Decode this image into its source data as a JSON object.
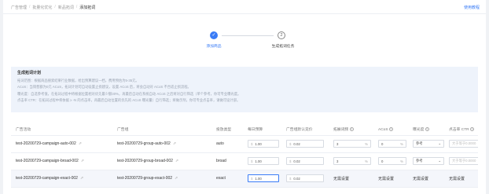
{
  "breadcrumb": [
    "广告管理",
    "批量化优化",
    "新品拓词",
    "添加拓词"
  ],
  "help_link": "使用教程",
  "steps": [
    {
      "num": "✓",
      "label": "添加商品"
    },
    {
      "num": "2",
      "label": "生成拓词任务"
    }
  ],
  "notice": {
    "title": "生成拓词计划",
    "lines": [
      "拓词范围：根据商品搜索结果行业数据，给出预算建议一档，费用预估为5-35元。",
      "ACoS：当销售额为0元 ACoS，拓词计划可自动设置止损建议，设置 ACoS 后，将会自动对 ACoS 不合适止损流程。",
      "曝光度：自选参考值，在拓词过程中将根据位置相对优先最少额30%，再最后自动在系统自动 ACoS 之后将对自行筛选（单个参考，你可专业曝光度。",
      "点击率 CTR：在拓词过程中将依据 ≥ -N 的点击率，再最后自动位置的优先的 ACoS 曝光量）自行筛选；将做示剂，你可专业点击率，请做可设计部。"
    ]
  },
  "table": {
    "headers": {
      "campaign": "广告活动",
      "group": "广告组",
      "match": "投放类型",
      "budget": "每日预算",
      "bid": "广告组默认竞价",
      "bid_step": "拓展词频",
      "acos": "ACoS",
      "impression": "曝光度",
      "ctr": "点击率 CTR"
    },
    "currency": "$",
    "percent": "%",
    "ctr_placeholder": "大于等于0.0000",
    "none_text": "无需设置",
    "rows": [
      {
        "campaign": "test-20200729-campaign-auto-002",
        "group": "test-20200729-group-auto-002",
        "match": "auto",
        "budget": "1.00",
        "bid": "0.02",
        "bid_step": "3",
        "acos": "0",
        "impression": "参考"
      },
      {
        "campaign": "test-20200729-campaign-broad-002",
        "group": "test-20200729-group-broad-002",
        "match": "broad",
        "budget": "1.00",
        "bid": "0.02",
        "bid_step": "3",
        "acos": "0",
        "impression": "参考"
      },
      {
        "campaign": "test-20200729-campaign-exact-002",
        "group": "test-20200729-group-exact-002",
        "match": "exact",
        "budget": "1.00",
        "bid": "0.02"
      }
    ]
  },
  "colors": {
    "accent": "#3a7cf6",
    "notice_bg": "#eef3fb"
  }
}
